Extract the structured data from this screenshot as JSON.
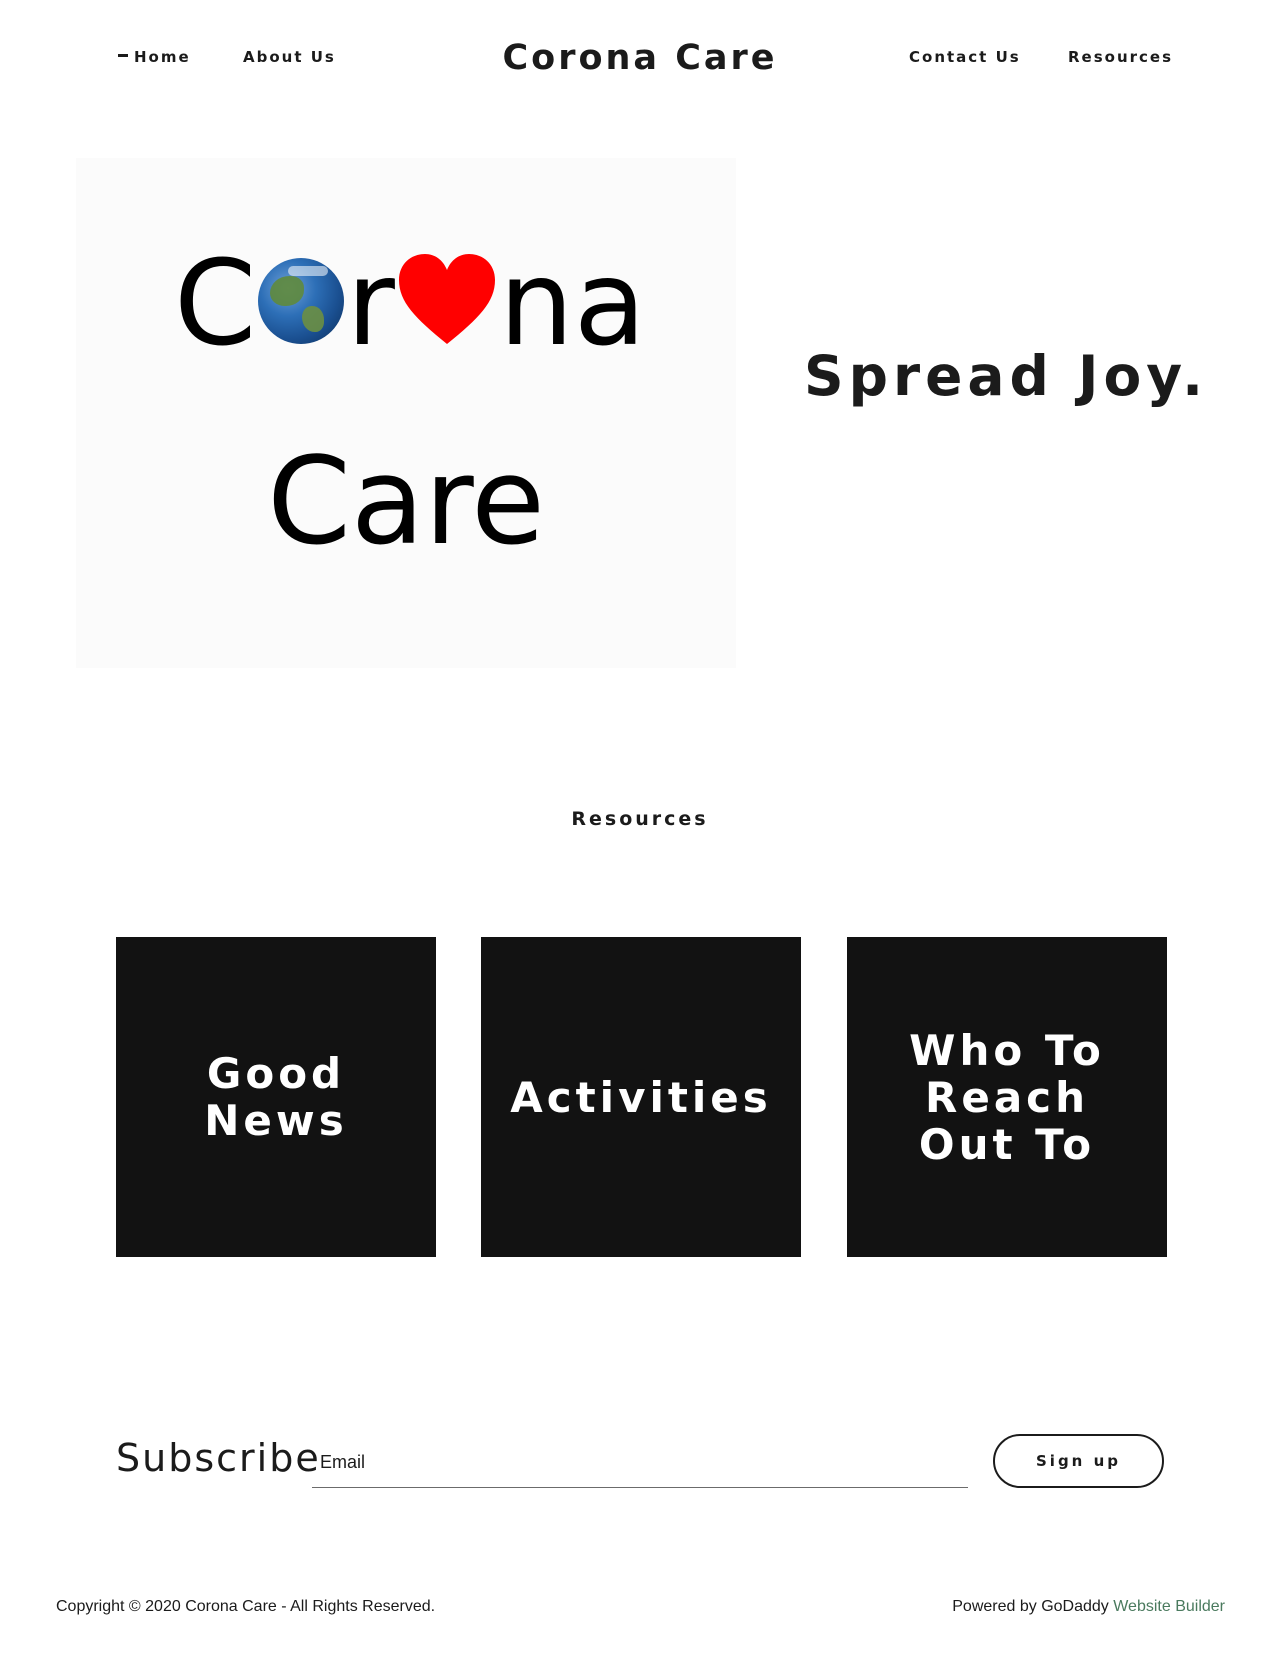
{
  "nav": {
    "home": "Home",
    "about": "About Us",
    "contact": "Contact Us",
    "resources": "Resources"
  },
  "site_title": "Corona Care",
  "hero": {
    "logo_c": "C",
    "logo_r": "r",
    "logo_na": "na",
    "logo_line2": "Care",
    "tagline": "Spread Joy."
  },
  "resources": {
    "title": "Resources",
    "tiles": [
      {
        "label": "Good News"
      },
      {
        "label": "Activities"
      },
      {
        "label": "Who To Reach Out To"
      }
    ]
  },
  "subscribe": {
    "label": "Subscribe",
    "email_placeholder": "Email",
    "button": "Sign up"
  },
  "footer": {
    "copyright": "Copyright © 2020 Corona Care - All Rights Reserved.",
    "powered_prefix": "Powered by GoDaddy",
    "powered_link": "Website Builder"
  },
  "colors": {
    "text": "#1b1b1b",
    "tile_bg": "#121212",
    "heart": "#ff0000",
    "link_green": "#4a7a5e"
  }
}
